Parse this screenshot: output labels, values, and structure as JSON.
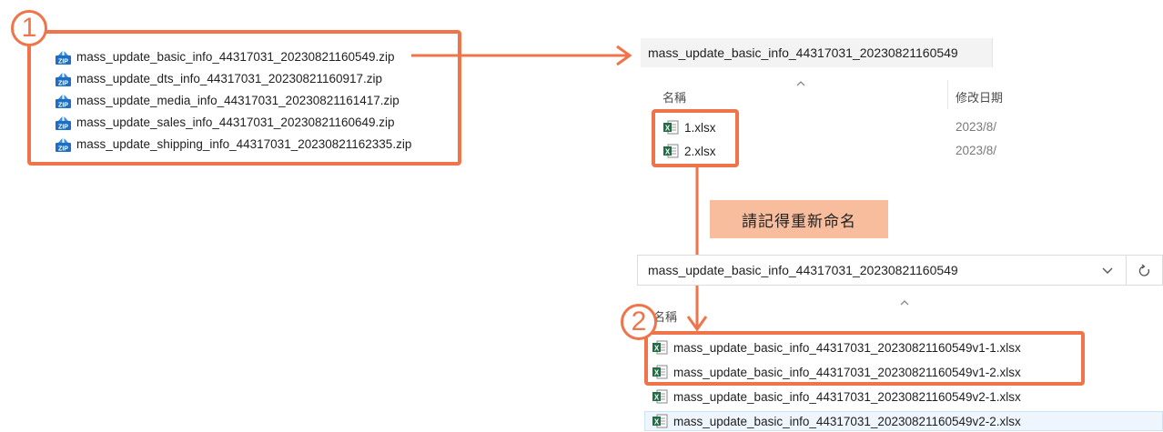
{
  "badges": {
    "first": "1",
    "second": "2"
  },
  "zip_files": [
    "mass_update_basic_info_44317031_20230821160549.zip",
    "mass_update_dts_info_44317031_20230821160917.zip",
    "mass_update_media_info_44317031_20230821161417.zip",
    "mass_update_sales_info_44317031_20230821160649.zip",
    "mass_update_shipping_info_44317031_20230821162335.zip"
  ],
  "explorer_top": {
    "address": "mass_update_basic_info_44317031_20230821160549",
    "col_name": "名稱",
    "col_modified": "修改日期",
    "files": [
      {
        "name": "1.xlsx",
        "date": "2023/8/"
      },
      {
        "name": "2.xlsx",
        "date": "2023/8/"
      }
    ]
  },
  "note": "請記得重新命名",
  "explorer_bottom": {
    "address": "mass_update_basic_info_44317031_20230821160549",
    "col_name": "名稱",
    "dropdown_icon": "chevron-down",
    "refresh_icon": "refresh",
    "files": [
      "mass_update_basic_info_44317031_20230821160549v1-1.xlsx",
      "mass_update_basic_info_44317031_20230821160549v1-2.xlsx",
      "mass_update_basic_info_44317031_20230821160549v2-1.xlsx",
      "mass_update_basic_info_44317031_20230821160549v2-2.xlsx"
    ]
  },
  "colors": {
    "accent": "#f0744a",
    "note_bg": "#f8bd9d",
    "excel_green": "#1d7044",
    "zip_blue": "#1e6fc4"
  }
}
